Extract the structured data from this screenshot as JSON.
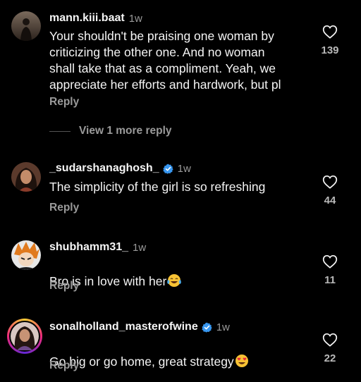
{
  "comments": [
    {
      "username": "mann.kiii.baat",
      "verified": false,
      "time": "1w",
      "text": "Your shouldn't be praising one woman by\ncriticizing the other one. And no woman\nshall take that as a compliment. Yeah, we\nappreciate her efforts and hardwork, but pl",
      "reply_label": "Reply",
      "likes": "139",
      "view_more": "View 1 more reply"
    },
    {
      "username": "_sudarshanaghosh_",
      "verified": true,
      "time": "1w",
      "text": "The simplicity of the girl is so refreshing",
      "reply_label": "Reply",
      "likes": "44"
    },
    {
      "username": "shubhamm31_",
      "verified": false,
      "time": "1w",
      "text": "Bro is in love with her",
      "emoji": "face-with-tears-of-joy",
      "reply_label": "Reply",
      "likes": "11"
    },
    {
      "username": "sonalholland_masterofwine",
      "verified": true,
      "time": "1w",
      "text": "Go big or go home, great strategy",
      "emoji": "smiling-face-with-heart-eyes",
      "reply_label": "Reply",
      "likes": "22"
    }
  ],
  "colors": {
    "background": "#000000",
    "text": "#f5f5f5",
    "muted": "#9a9a9a",
    "verified": "#3897f0"
  },
  "icons": [
    "heart-outline-icon",
    "verified-badge-icon"
  ]
}
